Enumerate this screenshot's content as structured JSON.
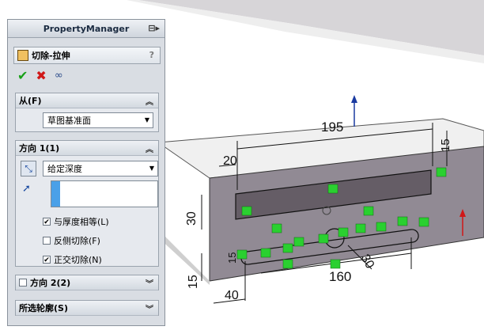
{
  "property_manager": {
    "title": "PropertyManager",
    "feature_name": "切除-拉伸",
    "help": "?",
    "ok": "✔",
    "cancel": "✖",
    "preview": "∞"
  },
  "from_group": {
    "label": "从(F)",
    "select_value": "草图基准面"
  },
  "direction1_group": {
    "label": "方向 1(1)",
    "select_value": "给定深度",
    "checkboxes": [
      {
        "label": "与厚度相等(L)",
        "checked": true
      },
      {
        "label": "反侧切除(F)",
        "checked": false
      },
      {
        "label": "正交切除(N)",
        "checked": true
      }
    ]
  },
  "direction2_group": {
    "label": "方向 2(2)"
  },
  "contours_group": {
    "label": "所选轮廓(S)"
  },
  "dimensions": [
    "195",
    "15",
    "20",
    "30",
    "15",
    "15",
    "160",
    "40",
    "30"
  ]
}
